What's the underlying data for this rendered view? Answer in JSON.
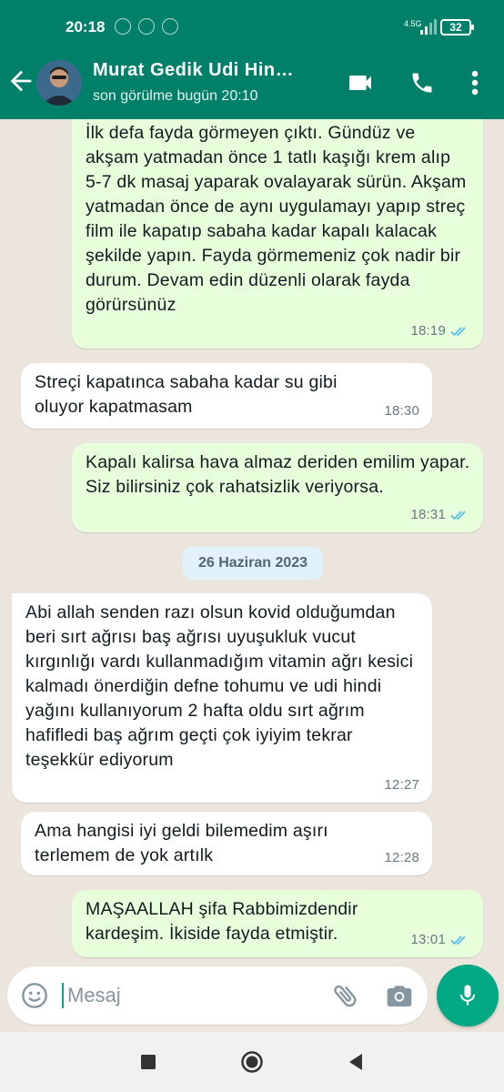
{
  "status_bar": {
    "time": "20:18",
    "network": "4.5G",
    "battery": "32"
  },
  "header": {
    "contact_name": "Murat Gedik Udi Hin…",
    "last_seen": "son görülme bugün 20:10",
    "icons": [
      "back-arrow-icon",
      "avatar",
      "video-call-icon",
      "phone-call-icon",
      "more-vert-icon"
    ]
  },
  "messages": [
    {
      "direction": "out",
      "text": "İlk defa fayda görmeyen çıktı.  Gündüz ve akşam yatmadan önce 1 tatlı kaşığı krem alıp 5-7 dk masaj yaparak ovalayarak sürün. Akşam yatmadan önce de aynı uygulamayı yapıp streç film ile kapatıp sabaha kadar kapalı kalacak şekilde yapın. Fayda görmemeniz çok nadir bir durum. Devam edin düzenli olarak fayda görürsünüz",
      "time": "18:19",
      "status": "read"
    },
    {
      "direction": "in",
      "text": "Streçi kapatınca sabaha kadar su gibi oluyor kapatmasam",
      "time": "18:30"
    },
    {
      "direction": "out",
      "text": "Kapalı kalirsa hava almaz deriden emilim yapar. Siz bilirsiniz çok rahatsizlik veriyorsa.",
      "time": "18:31",
      "status": "read"
    },
    {
      "type": "date",
      "text": "26 Haziran 2023"
    },
    {
      "direction": "in",
      "text": "Abi allah senden razı olsun kovid olduğumdan beri sırt ağrısı baş ağrısı uyuşukluk vucut kırgınlığı vardı kullanmadığım vitamin ağrı kesici kalmadı önerdiğin defne tohumu ve udi hindi yağını kullanıyorum 2 hafta oldu sırt ağrım hafifledi baş ağrım geçti çok iyiyim tekrar teşekkür ediyorum",
      "time": "12:27"
    },
    {
      "direction": "in",
      "text": "Ama hangisi iyi geldi bilemedim aşırı terlemem de yok artılk",
      "time": "12:28"
    },
    {
      "direction": "out",
      "text": "MAŞAALLAH şifa Rabbimizdendir kardeşim. İkiside fayda etmiştir.",
      "time": "13:01",
      "status": "read"
    }
  ],
  "composer": {
    "placeholder": "Mesaj"
  },
  "colors": {
    "header": "#008069",
    "outgoing_bubble": "#e7ffdb",
    "incoming_bubble": "#ffffff",
    "read_ticks": "#53bdeb",
    "mic_button": "#00a884"
  }
}
